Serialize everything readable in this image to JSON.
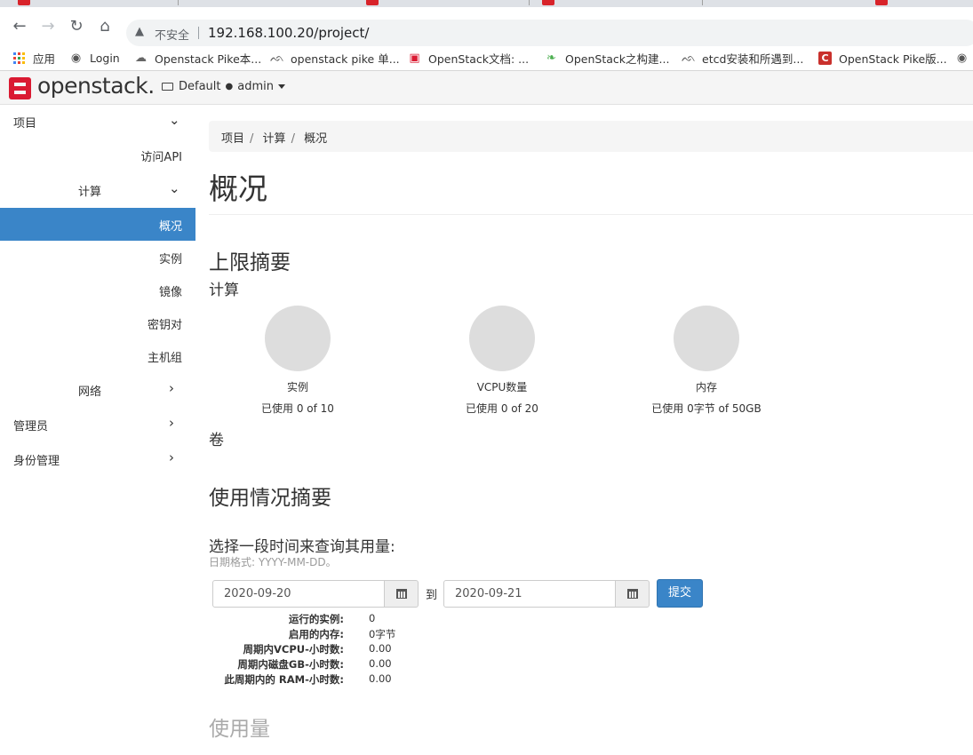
{
  "browser": {
    "insecure_label": "不安全",
    "url": "192.168.100.20/project/",
    "bookmarks": [
      {
        "label": "应用",
        "icon": "apps-grid-icon"
      },
      {
        "label": "Login",
        "icon": "globe-icon"
      },
      {
        "label": "Openstack Pike本...",
        "icon": "cloud-icon"
      },
      {
        "label": "openstack pike 单...",
        "icon": "bookmark-icon"
      },
      {
        "label": "OpenStack文档: ...",
        "icon": "openstack-icon"
      },
      {
        "label": "OpenStack之构建...",
        "icon": "leaf-icon"
      },
      {
        "label": "etcd安装和所遇到...",
        "icon": "bookmark-icon"
      },
      {
        "label": "OpenStack Pike版...",
        "icon": "c-logo-icon"
      }
    ]
  },
  "header": {
    "logo": "openstack.",
    "domain": "Default",
    "project": "admin"
  },
  "sidebar": {
    "project": "项目",
    "api_access": "访问API",
    "compute": "计算",
    "overview": "概况",
    "instances": "实例",
    "images": "镜像",
    "key_pairs": "密钥对",
    "server_groups": "主机组",
    "network": "网络",
    "admin": "管理员",
    "identity": "身份管理"
  },
  "breadcrumb": [
    "项目",
    "计算",
    "概况"
  ],
  "page_title": "概况",
  "limits": {
    "heading": "上限摘要",
    "compute_heading": "计算",
    "volume_heading": "卷",
    "pies": [
      {
        "label": "实例",
        "usage": "已使用 0 of 10",
        "fraction": 0
      },
      {
        "label": "VCPU数量",
        "usage": "已使用 0 of 20",
        "fraction": 0
      },
      {
        "label": "内存",
        "usage": "已使用 0字节 of 50GB",
        "fraction": 0
      }
    ]
  },
  "usage": {
    "heading": "使用情况摘要",
    "query_label": "选择一段时间来查询其用量:",
    "date_hint": "日期格式: YYYY-MM-DD。",
    "start_date": "2020-09-20",
    "to_label": "到",
    "end_date": "2020-09-21",
    "submit_label": "提交",
    "stats": [
      {
        "k": "运行的实例:",
        "v": "0"
      },
      {
        "k": "启用的内存:",
        "v": "0字节"
      },
      {
        "k": "周期内VCPU-小时数:",
        "v": "0.00"
      },
      {
        "k": "周期内磁盘GB-小时数:",
        "v": "0.00"
      },
      {
        "k": "此周期内的 RAM-小时数:",
        "v": "0.00"
      }
    ],
    "usage_title": "使用量"
  }
}
